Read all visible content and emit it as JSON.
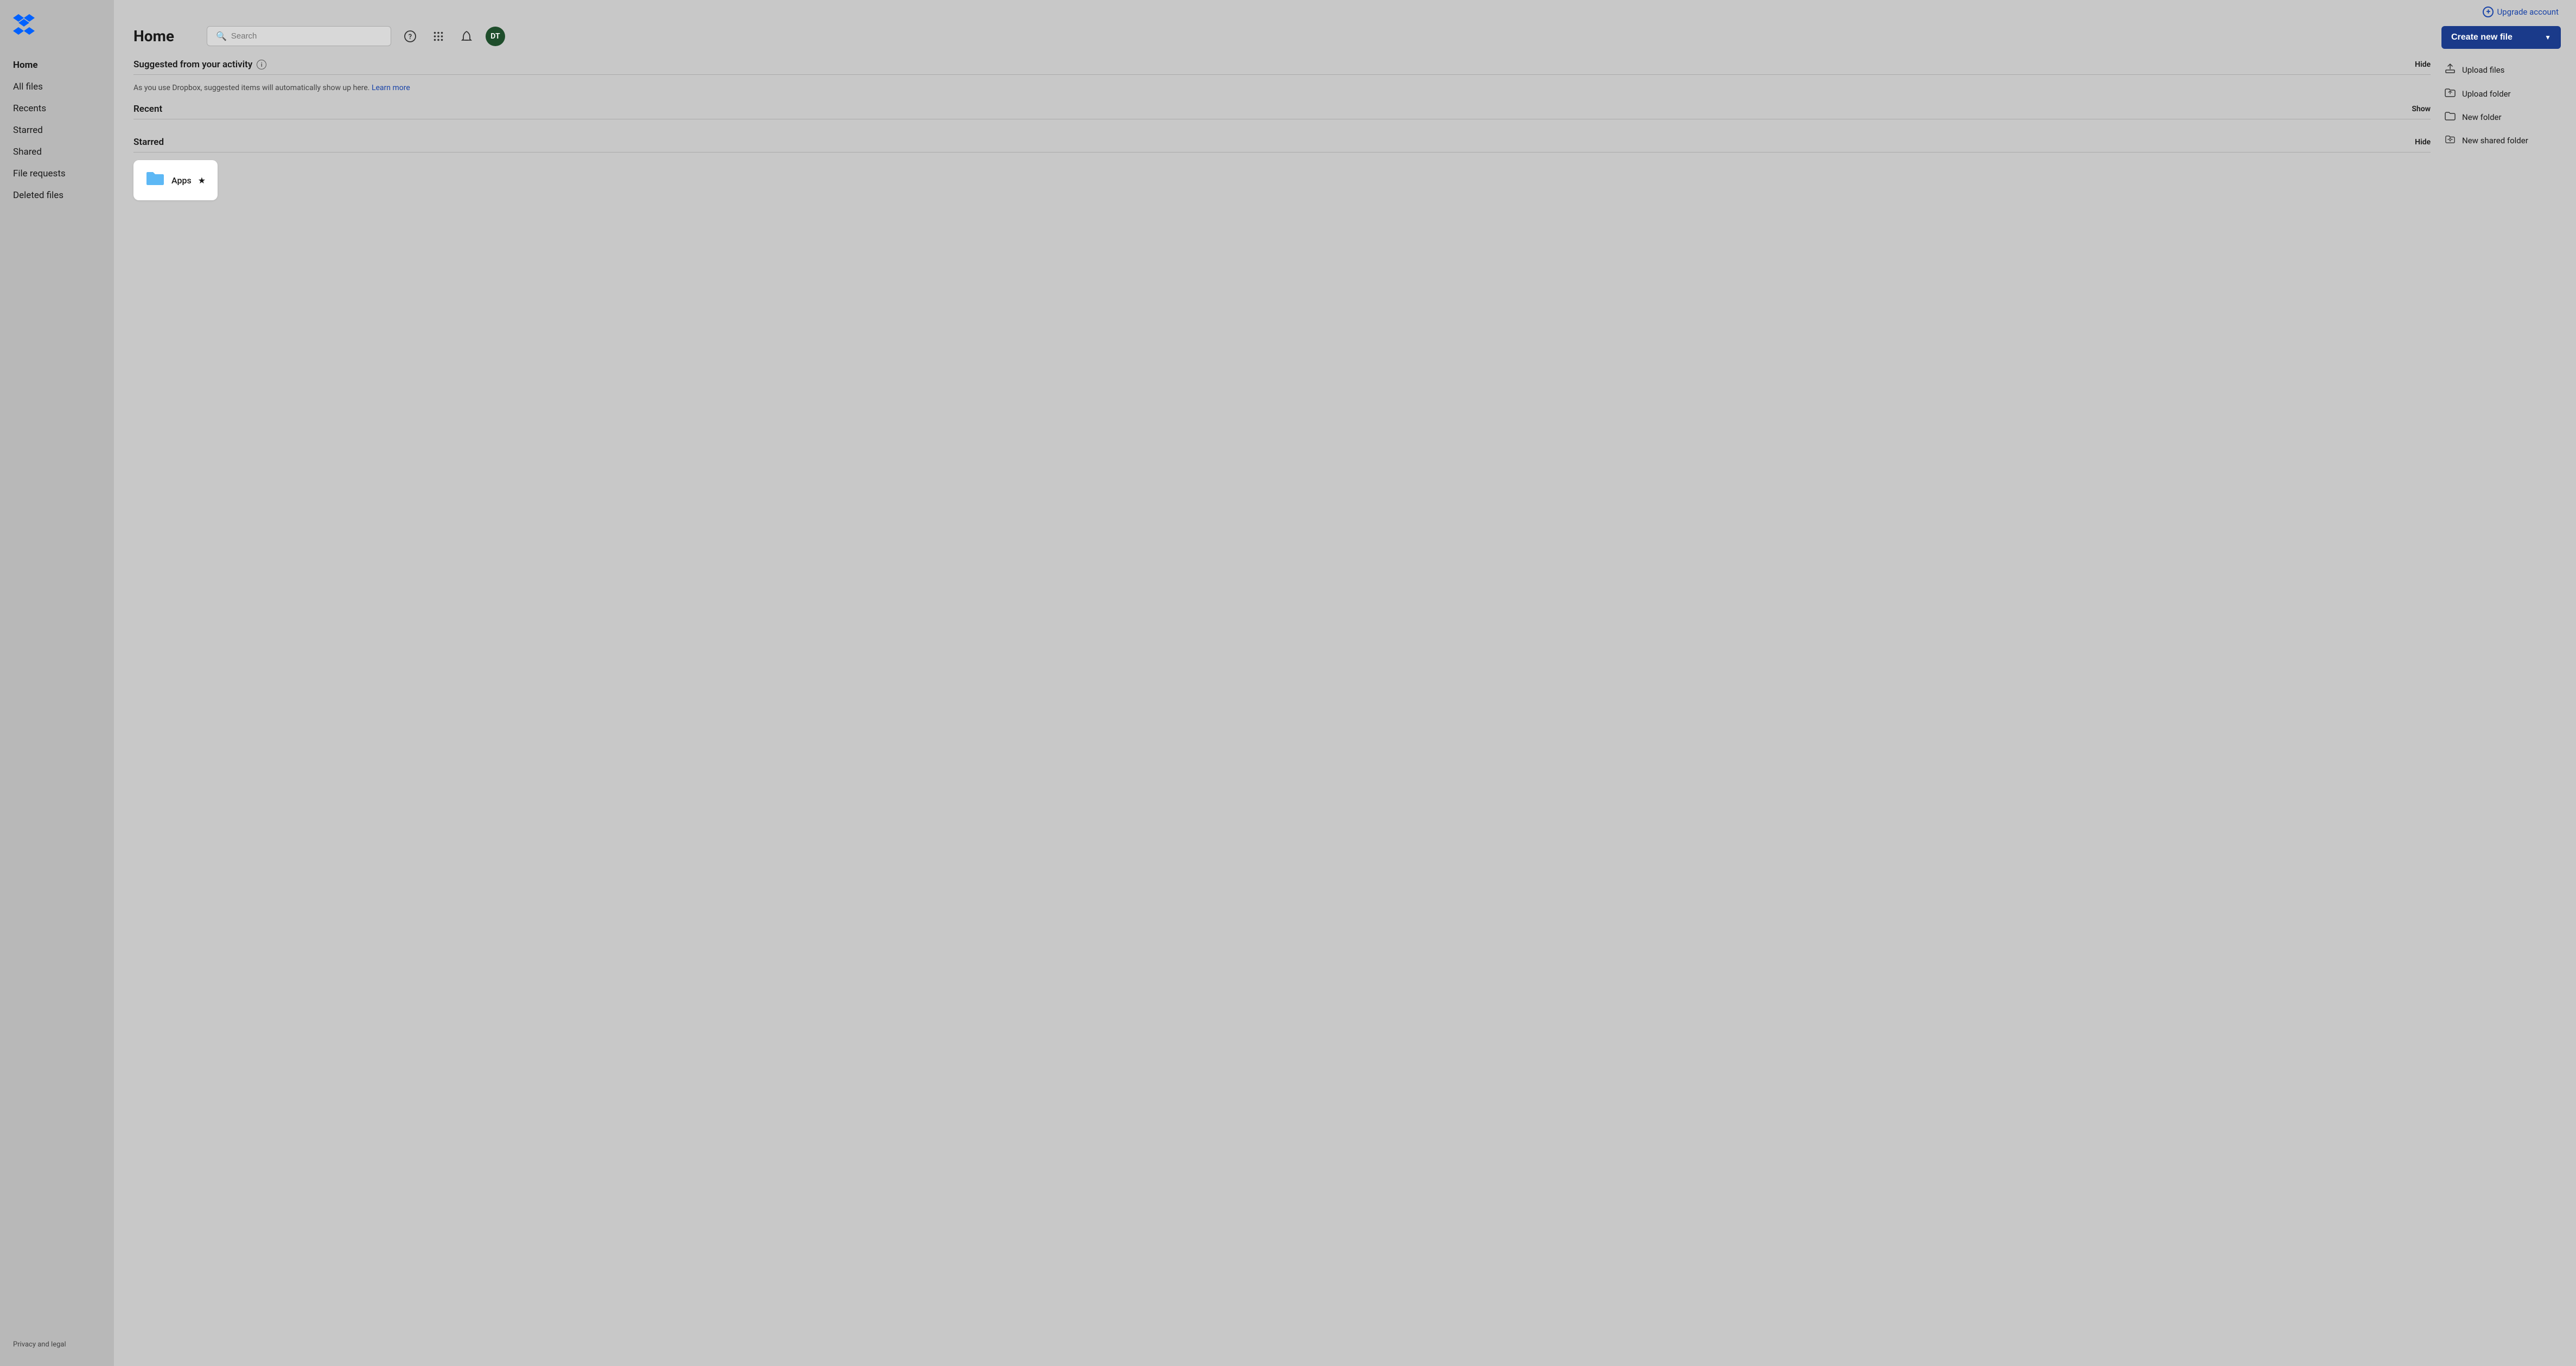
{
  "sidebar": {
    "nav_items": [
      {
        "label": "Home",
        "active": true,
        "name": "home"
      },
      {
        "label": "All files",
        "active": false,
        "name": "all-files"
      },
      {
        "label": "Recents",
        "active": false,
        "name": "recents"
      },
      {
        "label": "Starred",
        "active": false,
        "name": "starred"
      },
      {
        "label": "Shared",
        "active": false,
        "name": "shared"
      },
      {
        "label": "File requests",
        "active": false,
        "name": "file-requests"
      },
      {
        "label": "Deleted files",
        "active": false,
        "name": "deleted-files"
      }
    ],
    "footer": "Privacy and legal"
  },
  "topbar": {
    "upgrade_label": "Upgrade account",
    "search_placeholder": "Search",
    "avatar_initials": "DT"
  },
  "page": {
    "title": "Home"
  },
  "suggested_section": {
    "title": "Suggested from your activity",
    "action": "Hide",
    "body_text": "As you use Dropbox, suggested items will automatically show up here.",
    "learn_more": "Learn more"
  },
  "recent_section": {
    "title": "Recent",
    "action": "Show"
  },
  "starred_section": {
    "title": "Starred",
    "action": "Hide",
    "items": [
      {
        "name": "Apps",
        "type": "folder",
        "starred": true
      }
    ]
  },
  "actions": {
    "create_new_file": "Create new file",
    "upload_files": "Upload files",
    "upload_folder": "Upload folder",
    "new_folder": "New folder",
    "new_shared_folder": "New shared folder"
  }
}
